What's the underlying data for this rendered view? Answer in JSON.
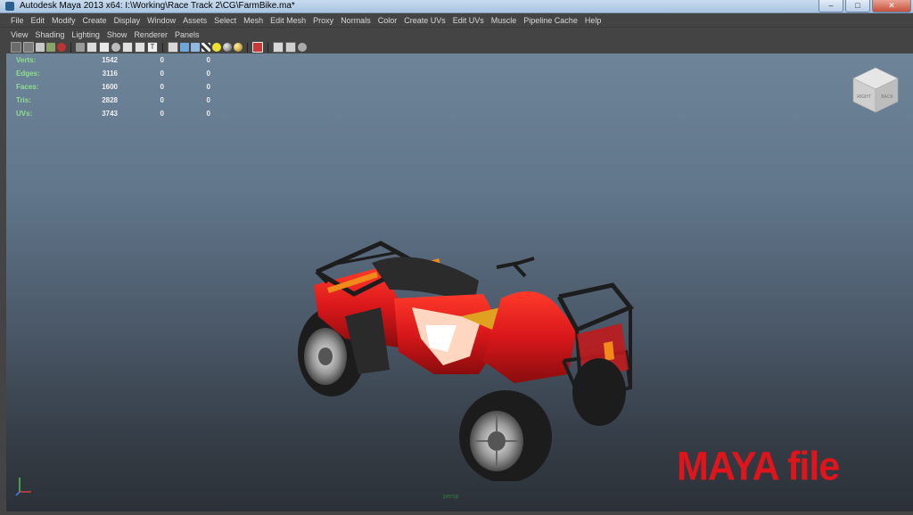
{
  "window": {
    "title": "Autodesk Maya 2013 x64: I:\\Working\\Race Track 2\\CG\\FarmBike.ma*",
    "minimize": "–",
    "maximize": "□",
    "close": "✕"
  },
  "menubar": [
    "File",
    "Edit",
    "Modify",
    "Create",
    "Display",
    "Window",
    "Assets",
    "Select",
    "Mesh",
    "Edit Mesh",
    "Proxy",
    "Normals",
    "Color",
    "Create UVs",
    "Edit UVs",
    "Muscle",
    "Pipeline Cache",
    "Help"
  ],
  "panel_menu": [
    "View",
    "Shading",
    "Lighting",
    "Show",
    "Renderer",
    "Panels"
  ],
  "toolbar_icons": [
    "select-camera-icon",
    "camera-attributes-icon",
    "bookmark-icon",
    "image-plane-icon",
    "grid-icon",
    "wireframe-icon",
    "smooth-shade-icon",
    "textured-icon",
    "default-lighting-icon",
    "shadows-icon",
    "xray-icon",
    "isolate-select-icon",
    "cube-icon",
    "cube-shaded-icon",
    "cube-wire-icon",
    "checker-icon",
    "bulb-icon",
    "sphere-icon",
    "gold-sphere-icon",
    "xray-joint-icon",
    "cube-outline-icon",
    "two-cubes-icon",
    "hierarchy-icon"
  ],
  "hud": {
    "rows": [
      {
        "label": "Verts:",
        "value": "1542",
        "sel": "0",
        "comp": "0"
      },
      {
        "label": "Edges:",
        "value": "3116",
        "sel": "0",
        "comp": "0"
      },
      {
        "label": "Faces:",
        "value": "1600",
        "sel": "0",
        "comp": "0"
      },
      {
        "label": "Tris:",
        "value": "2828",
        "sel": "0",
        "comp": "0"
      },
      {
        "label": "UVs:",
        "value": "3743",
        "sel": "0",
        "comp": "0"
      }
    ]
  },
  "viewcube": {
    "left_face": "RIGHT",
    "right_face": "BACK"
  },
  "viewport": {
    "camera_label": "persp"
  },
  "overlay": {
    "label": "MAYA file"
  },
  "colors": {
    "bike_red": "#d8171a",
    "overlay_red": "#e0141b",
    "hud_green": "#8de08d"
  }
}
